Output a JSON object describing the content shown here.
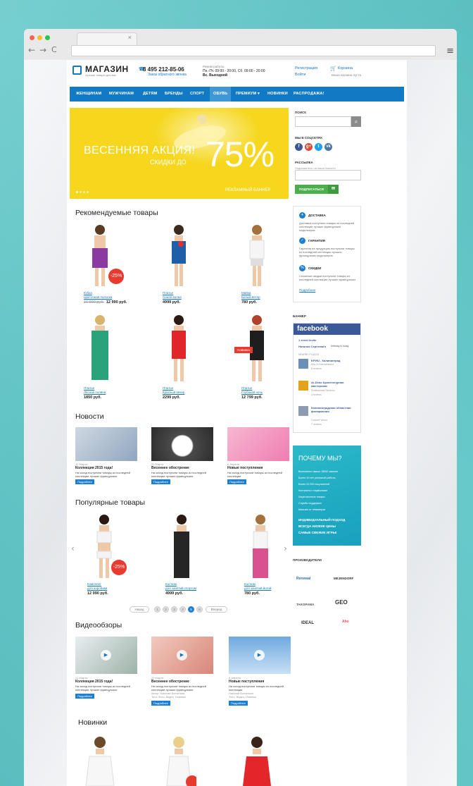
{
  "browser": {
    "tab_close": "×",
    "back": "←",
    "forward": "→",
    "reload": "C",
    "menu": "≡"
  },
  "header": {
    "logo": "МАГАЗИН",
    "logo_sub": "лучшие товары для вас",
    "phone": "8 495 212-85-06",
    "callback": "Заказ обратного звонка",
    "hours_label": "Режим работы:",
    "hours": "Пн.-Пт. 09:00 - 20:00, Сб. 09:00 - 20:00",
    "hours_sun": "Вс. Выходной",
    "register": "Регистрация",
    "login": "Войти",
    "cart": "Корзина",
    "cart_empty": "Ваша корзина пуста"
  },
  "nav": [
    "ЖЕНЩИНАМ",
    "МУЖЧИНАМ",
    "ДЕТЯМ",
    "БРЕНДЫ",
    "СПОРТ",
    "ОБУВЬ",
    "ПРЕМИУМ ▾",
    "НОВИНКИ",
    "РАСПРОДАЖА!"
  ],
  "banner": {
    "line1": "ВЕСЕННЯЯ АКЦИЯ!",
    "line2": "СКИДКИ ДО",
    "big": "75%",
    "footer": "РЕКЛАМНЫЙ БАННЕР"
  },
  "sidebar": {
    "search_label": "ПОИСК",
    "search_icon": "search-icon",
    "social_label": "МЫ В СОЦСЕТЯХ",
    "social": [
      {
        "g": "f",
        "c": "#3b5998"
      },
      {
        "g": "g+",
        "c": "#dd4b39"
      },
      {
        "g": "t",
        "c": "#1da1f2"
      },
      {
        "g": "vk",
        "c": "#4c75a3"
      }
    ],
    "newsletter_label": "РАССЫЛКА",
    "newsletter_hint": "Подпишитесь на наши новости",
    "subscribe": "ПОДПИСАТЬСЯ",
    "subscribe_icon": "✉",
    "info": [
      {
        "icon": "✈",
        "title": "ДОСТАВКА",
        "text": "Доставка поступили товары из последней коллекции лучших французских модельеров"
      },
      {
        "icon": "✓",
        "title": "ГАРАНТИЯ",
        "text": "Гарантия на продукцию поступили товары из последней коллекции лучших французских модельеров"
      },
      {
        "icon": "%",
        "title": "СКИДКИ",
        "text": "Сезонные скидки поступили товары из последней коллекции лучших французских"
      }
    ],
    "info_more": "Подробнее",
    "banner_label": "БАННЕР",
    "fb": {
      "head": "facebook",
      "l1": "1 event invite",
      "l2a": "Наталья Сергеева's",
      "l2b": "birthday is today",
      "nearby": "NEARBY PLACES",
      "places": [
        {
          "name": "KP.RU - Калининград",
          "cat": "Arts & Entertainment",
          "dist": "8 reviews"
        },
        {
          "name": "Ar-Deko Архитектурная мастерская",
          "cat": "Professional Services",
          "dist": "4 reviews"
        },
        {
          "name": "Калининградская областная филармония",
          "cat": "Concert Venue",
          "dist": "7 reviews"
        }
      ]
    },
    "why": {
      "title": "ПОЧЕМУ МЫ?",
      "items": [
        "Выполнено свыше 15000 заказов",
        "Более 10 лет успешной работы",
        "Более 20 000 покупателей",
        "Контракты с надёжными",
        "Лицензионные товары",
        "Службы поддержки",
        "Магазин от тёмимеров"
      ],
      "caps": [
        "ИНДИВИДУАЛЬНЫЙ ПОДХОД",
        "ВСЕГДА НИЗКИЕ ЦЕНЫ",
        "САМЫЕ СВЕЖИЕ ИГРЫ!"
      ]
    },
    "makers_label": "ПРОИЗВОДИТЕЛИ",
    "makers": [
      "Renewal",
      "MEJENDORF",
      "TAKOPAMA",
      "GEO",
      "IDEAL",
      "Aho"
    ]
  },
  "recommended": {
    "title": "Рекомендуемые товары",
    "items": [
      {
        "name": "Юбка",
        "sub": "Цветочная полоска",
        "old": "16 990 руб.",
        "price": "12 990 руб.",
        "badge": "-25%",
        "color": "#8a3aa0"
      },
      {
        "name": "Платье",
        "sub": "Синяя волна",
        "price": "4999 руб.",
        "color": "#1f5fa8"
      },
      {
        "name": "Майка",
        "sub": "Белый ветер",
        "price": "780 руб.",
        "color": "#f1f1f1"
      },
      {
        "name": "Платье",
        "sub": "Лесная поляна",
        "price": "1850 руб.",
        "color": "#2aa37a"
      },
      {
        "name": "Платье",
        "sub": "Красный вечер",
        "price": "2299 руб.",
        "color": "#e0262b"
      },
      {
        "name": "Платье",
        "sub": "Глубокая ночь",
        "price": "12 799 руб.",
        "badge": "Новинка",
        "color": "#222"
      }
    ]
  },
  "news": {
    "title": "Новости",
    "items": [
      {
        "date": "12 Марта",
        "title": "Коллекция 2015 года!",
        "text": "На склад поступили товары из последней коллекции лучших французских",
        "btn": "Подробнее"
      },
      {
        "date": "25 Марта",
        "title": "Весеннее обострение",
        "text": "На склад поступили товары из последней коллекции лучших французских",
        "btn": "Подробнее"
      },
      {
        "date": "6 Апреля",
        "title": "Новые поступления",
        "text": "На склад поступили товары из последней коллекции",
        "btn": "Подробнее"
      }
    ]
  },
  "popular": {
    "title": "Популярные товары",
    "prev": "‹",
    "next": "›",
    "items": [
      {
        "name": "Комплект",
        "sub": "для аэробики",
        "price": "12 990 руб.",
        "badge": "-25%",
        "color": "#f3f3f3"
      },
      {
        "name": "Костюм",
        "sub": "для занятий спортом",
        "price": "4999 руб.",
        "color": "#262626"
      },
      {
        "name": "Костюм",
        "sub": "для занятий йогой",
        "price": "780 руб.",
        "color": "#d9518f"
      }
    ],
    "pager": {
      "prev": "Назад",
      "pages": [
        "1",
        "2",
        "3",
        "4",
        "5",
        "6"
      ],
      "next": "Вперед",
      "active": "5"
    }
  },
  "videos": {
    "title": "Видеообзоры",
    "play": "▶",
    "items": [
      {
        "date": "12 Марта",
        "title": "Коллекция 2015 года!",
        "text": "На склад поступили товары из последней коллекции лучших французских",
        "btn": "Подробнее"
      },
      {
        "date": "25 Марта",
        "title": "Весеннее обострение",
        "text": "На склад поступили товары из последней коллекции лучших французских",
        "m1": "Автор: Николай Волченков",
        "m2": "Теги: Фото, Видео, Новинки",
        "btn": "Подробнее"
      },
      {
        "date": "6 Апреля",
        "title": "Новые поступления",
        "text": "На склад поступили товары из последней коллекции",
        "m1": "Николай Волченков",
        "m2": "Фото, Видео, Новинки",
        "btn": "Подробнее"
      }
    ]
  },
  "novelties": {
    "title": "Новинки"
  }
}
